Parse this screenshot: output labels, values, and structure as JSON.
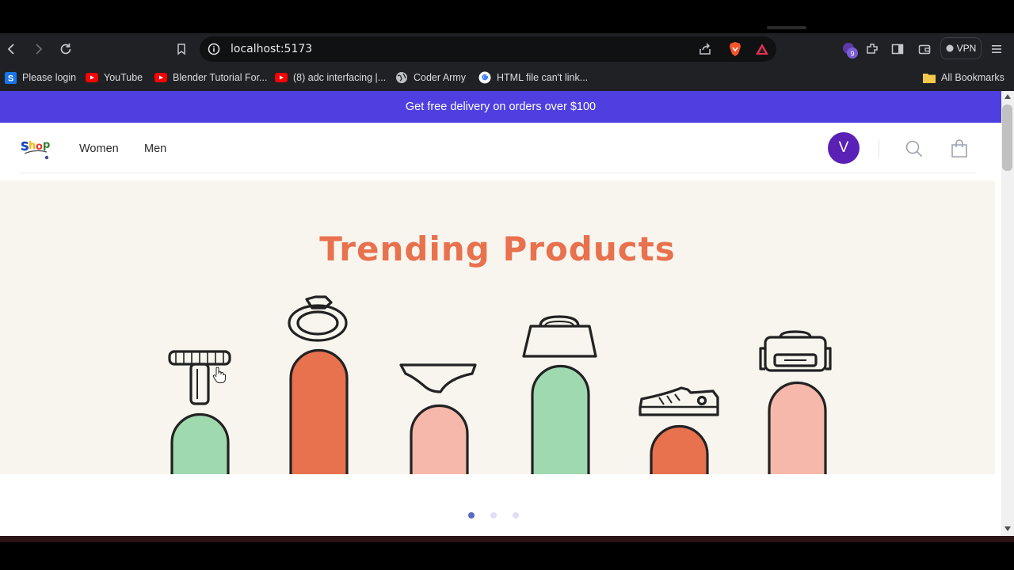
{
  "browser": {
    "url": "localhost:5173",
    "vpn_label": "VPN",
    "extensions_badge": "9",
    "bookmarks": [
      {
        "label": "Please login",
        "icon": "s-favicon"
      },
      {
        "label": "YouTube",
        "icon": "youtube-icon"
      },
      {
        "label": "Blender Tutorial For...",
        "icon": "youtube-icon"
      },
      {
        "label": "(8) adc interfacing |...",
        "icon": "youtube-icon"
      },
      {
        "label": "Coder Army",
        "icon": "globe-icon"
      },
      {
        "label": "HTML file can't link...",
        "icon": "google-icon"
      }
    ],
    "all_bookmarks": "All Bookmarks"
  },
  "site": {
    "promo": "Get free delivery on orders over $100",
    "logo_alt": "Shop",
    "nav": [
      {
        "label": "Women"
      },
      {
        "label": "Men"
      }
    ],
    "avatar_initial": "V",
    "hero_title": "Trending Products",
    "carousel": {
      "count": 3,
      "active_index": 0
    }
  },
  "colors": {
    "promo_bg": "#4f3fe0",
    "avatar_bg": "#5b21b6",
    "hero_orange": "#e8714e",
    "bar_green": "#9fd9b0",
    "bar_pink": "#f5b8aa",
    "hero_bg": "#f8f5ee"
  }
}
